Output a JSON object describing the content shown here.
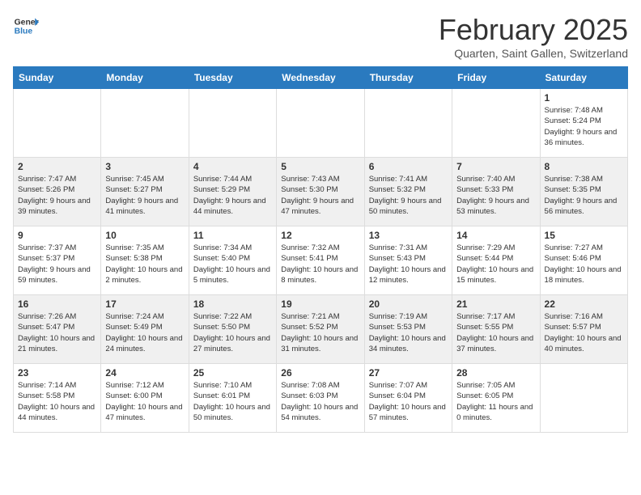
{
  "header": {
    "logo_general": "General",
    "logo_blue": "Blue",
    "month_year": "February 2025",
    "location": "Quarten, Saint Gallen, Switzerland"
  },
  "weekdays": [
    "Sunday",
    "Monday",
    "Tuesday",
    "Wednesday",
    "Thursday",
    "Friday",
    "Saturday"
  ],
  "weeks": [
    [
      {
        "day": "",
        "detail": ""
      },
      {
        "day": "",
        "detail": ""
      },
      {
        "day": "",
        "detail": ""
      },
      {
        "day": "",
        "detail": ""
      },
      {
        "day": "",
        "detail": ""
      },
      {
        "day": "",
        "detail": ""
      },
      {
        "day": "1",
        "detail": "Sunrise: 7:48 AM\nSunset: 5:24 PM\nDaylight: 9 hours and 36 minutes."
      }
    ],
    [
      {
        "day": "2",
        "detail": "Sunrise: 7:47 AM\nSunset: 5:26 PM\nDaylight: 9 hours and 39 minutes."
      },
      {
        "day": "3",
        "detail": "Sunrise: 7:45 AM\nSunset: 5:27 PM\nDaylight: 9 hours and 41 minutes."
      },
      {
        "day": "4",
        "detail": "Sunrise: 7:44 AM\nSunset: 5:29 PM\nDaylight: 9 hours and 44 minutes."
      },
      {
        "day": "5",
        "detail": "Sunrise: 7:43 AM\nSunset: 5:30 PM\nDaylight: 9 hours and 47 minutes."
      },
      {
        "day": "6",
        "detail": "Sunrise: 7:41 AM\nSunset: 5:32 PM\nDaylight: 9 hours and 50 minutes."
      },
      {
        "day": "7",
        "detail": "Sunrise: 7:40 AM\nSunset: 5:33 PM\nDaylight: 9 hours and 53 minutes."
      },
      {
        "day": "8",
        "detail": "Sunrise: 7:38 AM\nSunset: 5:35 PM\nDaylight: 9 hours and 56 minutes."
      }
    ],
    [
      {
        "day": "9",
        "detail": "Sunrise: 7:37 AM\nSunset: 5:37 PM\nDaylight: 9 hours and 59 minutes."
      },
      {
        "day": "10",
        "detail": "Sunrise: 7:35 AM\nSunset: 5:38 PM\nDaylight: 10 hours and 2 minutes."
      },
      {
        "day": "11",
        "detail": "Sunrise: 7:34 AM\nSunset: 5:40 PM\nDaylight: 10 hours and 5 minutes."
      },
      {
        "day": "12",
        "detail": "Sunrise: 7:32 AM\nSunset: 5:41 PM\nDaylight: 10 hours and 8 minutes."
      },
      {
        "day": "13",
        "detail": "Sunrise: 7:31 AM\nSunset: 5:43 PM\nDaylight: 10 hours and 12 minutes."
      },
      {
        "day": "14",
        "detail": "Sunrise: 7:29 AM\nSunset: 5:44 PM\nDaylight: 10 hours and 15 minutes."
      },
      {
        "day": "15",
        "detail": "Sunrise: 7:27 AM\nSunset: 5:46 PM\nDaylight: 10 hours and 18 minutes."
      }
    ],
    [
      {
        "day": "16",
        "detail": "Sunrise: 7:26 AM\nSunset: 5:47 PM\nDaylight: 10 hours and 21 minutes."
      },
      {
        "day": "17",
        "detail": "Sunrise: 7:24 AM\nSunset: 5:49 PM\nDaylight: 10 hours and 24 minutes."
      },
      {
        "day": "18",
        "detail": "Sunrise: 7:22 AM\nSunset: 5:50 PM\nDaylight: 10 hours and 27 minutes."
      },
      {
        "day": "19",
        "detail": "Sunrise: 7:21 AM\nSunset: 5:52 PM\nDaylight: 10 hours and 31 minutes."
      },
      {
        "day": "20",
        "detail": "Sunrise: 7:19 AM\nSunset: 5:53 PM\nDaylight: 10 hours and 34 minutes."
      },
      {
        "day": "21",
        "detail": "Sunrise: 7:17 AM\nSunset: 5:55 PM\nDaylight: 10 hours and 37 minutes."
      },
      {
        "day": "22",
        "detail": "Sunrise: 7:16 AM\nSunset: 5:57 PM\nDaylight: 10 hours and 40 minutes."
      }
    ],
    [
      {
        "day": "23",
        "detail": "Sunrise: 7:14 AM\nSunset: 5:58 PM\nDaylight: 10 hours and 44 minutes."
      },
      {
        "day": "24",
        "detail": "Sunrise: 7:12 AM\nSunset: 6:00 PM\nDaylight: 10 hours and 47 minutes."
      },
      {
        "day": "25",
        "detail": "Sunrise: 7:10 AM\nSunset: 6:01 PM\nDaylight: 10 hours and 50 minutes."
      },
      {
        "day": "26",
        "detail": "Sunrise: 7:08 AM\nSunset: 6:03 PM\nDaylight: 10 hours and 54 minutes."
      },
      {
        "day": "27",
        "detail": "Sunrise: 7:07 AM\nSunset: 6:04 PM\nDaylight: 10 hours and 57 minutes."
      },
      {
        "day": "28",
        "detail": "Sunrise: 7:05 AM\nSunset: 6:05 PM\nDaylight: 11 hours and 0 minutes."
      },
      {
        "day": "",
        "detail": ""
      }
    ]
  ]
}
